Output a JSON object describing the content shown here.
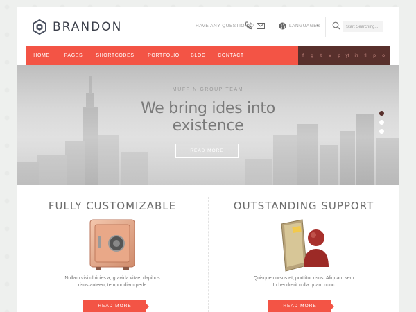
{
  "brand": {
    "name": "BRANDON"
  },
  "header": {
    "ask_label": "HAVE ANY QUESTIONS?",
    "languages_label": "LANGUAGES",
    "search_placeholder": "Start Searching..."
  },
  "nav": {
    "items": [
      {
        "label": "HOME",
        "active": true
      },
      {
        "label": "PAGES"
      },
      {
        "label": "SHORTCODES"
      },
      {
        "label": "PORTFOLIO"
      },
      {
        "label": "BLOG"
      },
      {
        "label": "CONTACT"
      }
    ],
    "social": [
      "f",
      "g",
      "t",
      "v",
      "p",
      "yt",
      "in",
      "fl",
      "p",
      "o"
    ]
  },
  "hero": {
    "subtitle": "MUFFIN GROUP TEAM",
    "title_line1": "We bring ides into",
    "title_line2": "existence",
    "button": "READ MORE",
    "slides": 3,
    "active_slide": 1
  },
  "features": [
    {
      "title": "FULLY CUSTOMIZABLE",
      "text_line1": "Nullam visi ultricies a, gravida vitae, dapibus",
      "text_line2": "risus anteeu, tempor diam pede",
      "button": "READ MORE",
      "icon": "safe-icon"
    },
    {
      "title": "OUTSTANDING SUPPORT",
      "text_line1": "Quisque cursus et, porttitor risus. Aliquam sem",
      "text_line2": "In hendrerit nulla quam nunc",
      "button": "READ MORE",
      "icon": "support-folder-icon"
    }
  ],
  "colors": {
    "accent": "#f35445",
    "social_bar": "#58302c",
    "text": "#6c6c6c"
  }
}
